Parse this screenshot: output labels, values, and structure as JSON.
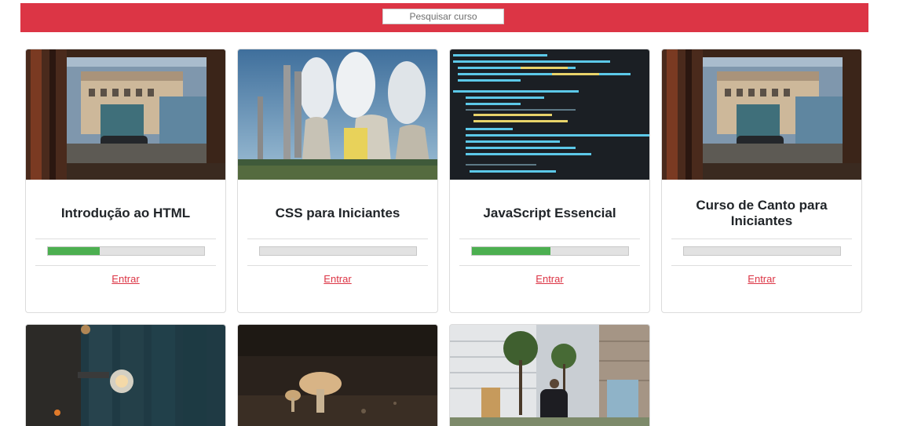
{
  "search": {
    "placeholder": "Pesquisar curso"
  },
  "courses": [
    {
      "title": "Introdução ao HTML",
      "progress": 0.33,
      "link": "Entrar",
      "image": "industrial-yard-photo"
    },
    {
      "title": "CSS para Iniciantes",
      "progress": 0.0,
      "link": "Entrar",
      "image": "power-plant-photo"
    },
    {
      "title": "JavaScript Essencial",
      "progress": 0.5,
      "link": "Entrar",
      "image": "code-screen-photo"
    },
    {
      "title": "Curso de Canto para Iniciantes",
      "progress": 0.0,
      "link": "Entrar",
      "image": "industrial-yard-photo"
    },
    {
      "image": "light-bulb-photo"
    },
    {
      "image": "mushroom-photo"
    },
    {
      "image": "street-walker-photo"
    }
  ],
  "colors": {
    "accent": "#dc3545",
    "progress": "#4caf50",
    "progress_track": "#e2e2e2"
  }
}
